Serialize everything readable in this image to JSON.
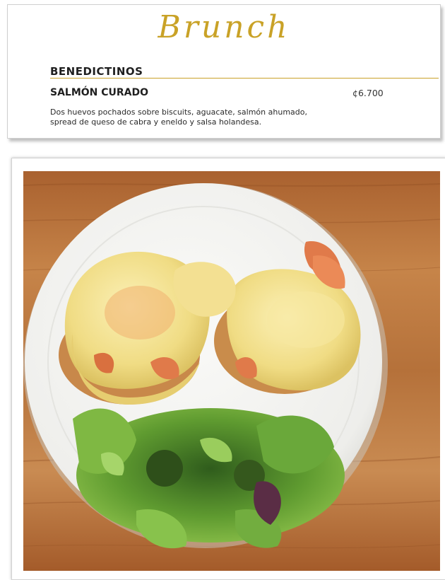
{
  "menu": {
    "brand": "Brunch",
    "section": "BENEDICTINOS",
    "dish": {
      "name": "SALMÓN CURADO",
      "price": "¢6.700",
      "description_line1": "Dos huevos pochados sobre biscuits, aguacate, salmón ahumado,",
      "description_line2": "spread de queso de cabra y eneldo y salsa holandesa."
    }
  },
  "colors": {
    "gold": "#c9a227",
    "text": "#1f1f1f",
    "wood": "#b8733c",
    "plate": "#f4f4f2",
    "hollandaise": "#f2df8c",
    "salmon": "#e07a4a",
    "greens": "#5e9a2e"
  },
  "photo": {
    "subject": "salmon-eggs-benedict-plate"
  }
}
